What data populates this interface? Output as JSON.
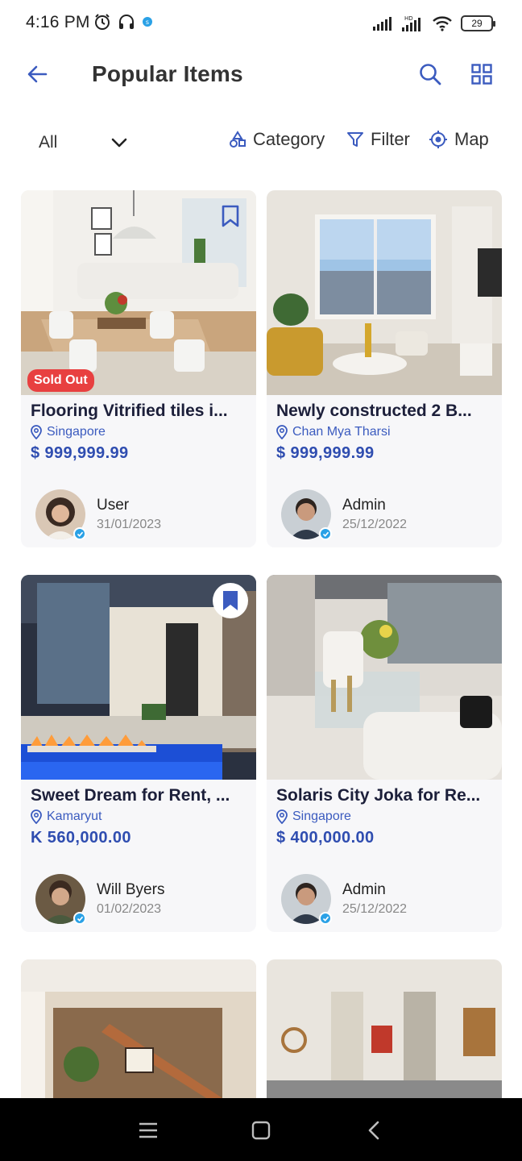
{
  "status_bar": {
    "time": "4:16 PM",
    "battery": "29",
    "icons": [
      "alarm-icon",
      "headphones-icon",
      "app-notification-icon",
      "signal-icon",
      "hd-signal-icon",
      "wifi-icon",
      "battery-icon"
    ]
  },
  "app_bar": {
    "title": "Popular Items",
    "icons": [
      "back-arrow-icon",
      "search-icon",
      "grid-view-icon"
    ]
  },
  "filters": {
    "all_label": "All",
    "category_label": "Category",
    "filter_label": "Filter",
    "map_label": "Map"
  },
  "colors": {
    "accent": "#3b5bbf",
    "price": "#2f4db0",
    "title": "#1c1f3a",
    "sold_badge": "#e84040",
    "verified": "#2aa1e6"
  },
  "items": [
    {
      "title": "Flooring Vitrified tiles i...",
      "location": "Singapore",
      "price": "$ 999,999.99",
      "owner": "User",
      "date": "31/01/2023",
      "badge": "Sold Out",
      "bookmarked": false
    },
    {
      "title": "Newly constructed 2 B...",
      "location": "Chan Mya Tharsi",
      "price": "$ 999,999.99",
      "owner": "Admin",
      "date": "25/12/2022",
      "badge": "",
      "bookmarked": false
    },
    {
      "title": "Sweet Dream for Rent, ...",
      "location": "Kamaryut",
      "price": "K 560,000.00",
      "owner": "Will Byers",
      "date": "01/02/2023",
      "badge": "",
      "bookmarked": true
    },
    {
      "title": "Solaris City Joka for Re...",
      "location": "Singapore",
      "price": "$ 400,000.00",
      "owner": "Admin",
      "date": "25/12/2022",
      "badge": "",
      "bookmarked": false
    }
  ],
  "nav": [
    "menu-icon",
    "home-icon",
    "back-icon"
  ]
}
